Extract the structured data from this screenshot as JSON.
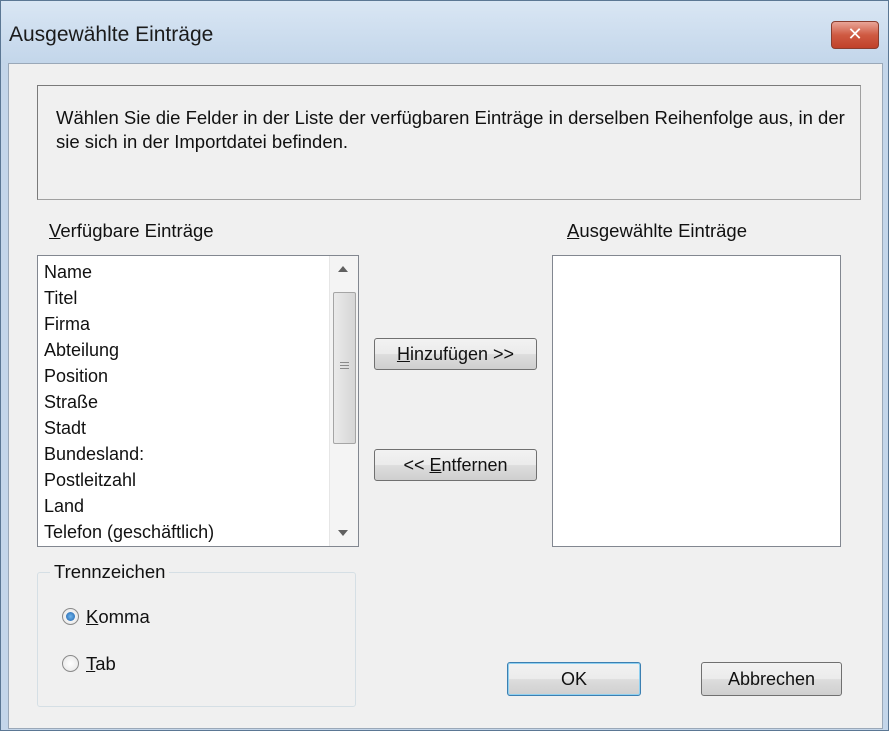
{
  "window": {
    "title": "Ausgewählte Einträge",
    "close_glyph": "✕"
  },
  "info_text": "Wählen Sie die Felder in der Liste der verfügbaren Einträge in derselben Reihenfolge aus, in der sie sich in der Importdatei befinden.",
  "available": {
    "label_accel": "V",
    "label_rest": "erfügbare Einträge",
    "items": [
      "Name",
      "Titel",
      "Firma",
      "Abteilung",
      "Position",
      "Straße",
      "Stadt",
      "Bundesland:",
      "Postleitzahl",
      "Land",
      "Telefon (geschäftlich)"
    ]
  },
  "selected": {
    "label_accel": "A",
    "label_rest": "usgewählte Einträge",
    "items": []
  },
  "buttons": {
    "add_accel": "H",
    "add_rest": "inzufügen >>",
    "remove_prefix": "<< ",
    "remove_accel": "E",
    "remove_rest": "ntfernen",
    "ok": "OK",
    "cancel": "Abbrechen"
  },
  "separator": {
    "title": "Trennzeichen",
    "options": [
      {
        "accel": "K",
        "rest": "omma",
        "selected": true
      },
      {
        "accel": "T",
        "rest": "ab",
        "selected": false
      }
    ]
  },
  "icons": {
    "close": "close-icon",
    "scroll_up": "scroll-up-arrow-icon",
    "scroll_down": "scroll-down-arrow-icon",
    "thumb_grip": "scroll-grip-icon"
  },
  "colors": {
    "title_bg": "#c4d6ea",
    "close_red": "#c7462f",
    "radio_selected": "#1f5fa8",
    "dialog_bg": "#f0f0f0"
  }
}
